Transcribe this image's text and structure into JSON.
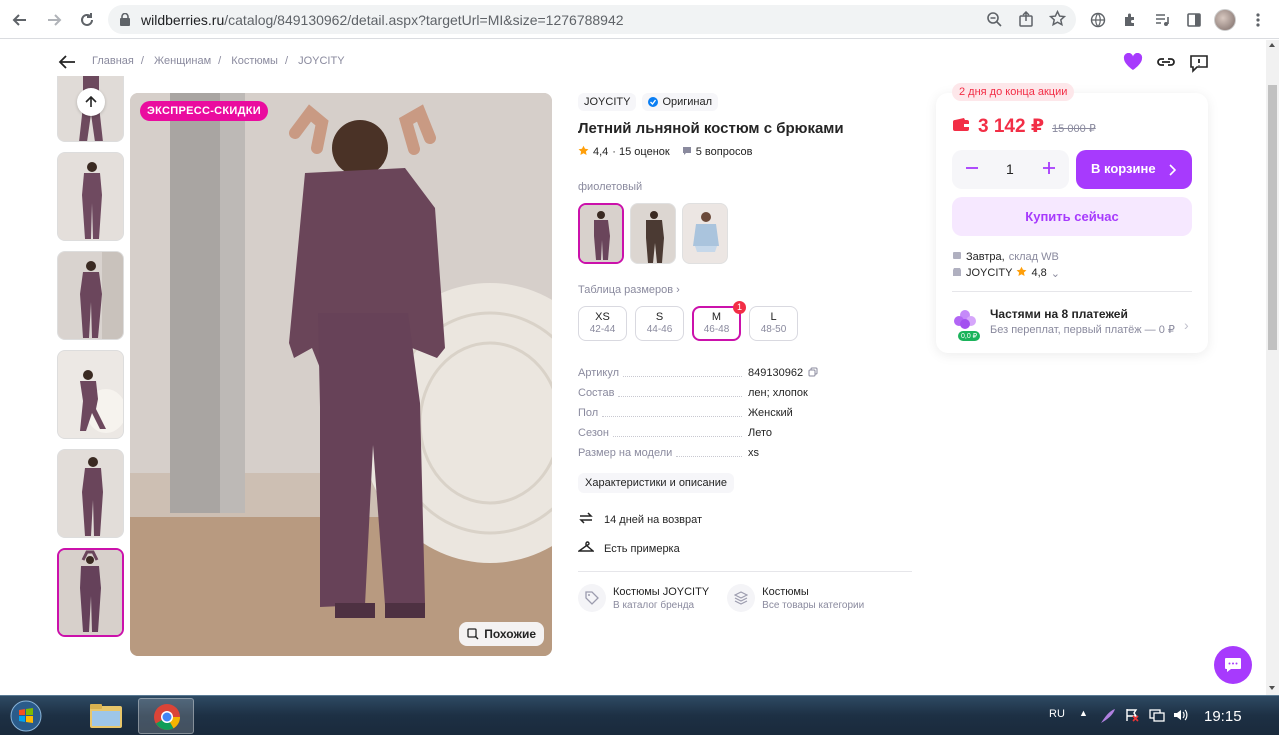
{
  "browser": {
    "url_host": "wildberries.ru",
    "url_rest": "/catalog/849130962/detail.aspx?targetUrl=MI&size=1276788942"
  },
  "breadcrumbs": [
    "Главная",
    "Женщинам",
    "Костюмы",
    "JOYCITY"
  ],
  "gallery": {
    "express_badge": "ЭКСПРЕСС-СКИДКИ",
    "similar_label": "Похожие"
  },
  "product": {
    "brand": "JOYCITY",
    "original_label": "Оригинал",
    "title": "Летний льняной костюм с брюками",
    "rating": "4,4",
    "reviews": "· 15 оценок",
    "questions": "5 вопросов",
    "color_label": "фиолетовый",
    "size_table_label": "Таблица размеров",
    "sizes": [
      {
        "name": "XS",
        "range": "42-44"
      },
      {
        "name": "S",
        "range": "44-46"
      },
      {
        "name": "M",
        "range": "46-48",
        "selected": true,
        "count": "1"
      },
      {
        "name": "L",
        "range": "48-50"
      }
    ],
    "specs": [
      {
        "k": "Артикул",
        "v": "849130962"
      },
      {
        "k": "Состав",
        "v": "лен; хлопок"
      },
      {
        "k": "Пол",
        "v": "Женский"
      },
      {
        "k": "Сезон",
        "v": "Лето"
      },
      {
        "k": "Размер на модели",
        "v": "xs"
      }
    ],
    "chars_button": "Характеристики и описание",
    "features": [
      "14 дней на возврат",
      "Есть примерка"
    ],
    "categories": [
      {
        "t1": "Костюмы JOYCITY",
        "t2": "В каталог бренда"
      },
      {
        "t1": "Костюмы",
        "t2": "Все товары категории"
      }
    ]
  },
  "buy": {
    "promo": "2 дня до конца акции",
    "price": "3 142 ₽",
    "old_price": "15 000 ₽",
    "qty": "1",
    "in_cart": "В корзине",
    "buy_now": "Купить сейчас",
    "delivery_day": "Завтра,",
    "delivery_place": "склад WB",
    "seller": "JOYCITY",
    "seller_rating": "4,8",
    "installments_title": "Частями на 8 платежей",
    "installments_sub": "Без переплат, первый платёж — 0 ₽",
    "installments_badge": "0,0 ₽"
  },
  "taskbar": {
    "lang": "RU",
    "clock": "19:15"
  },
  "colors": {
    "accent": "#a73afd",
    "brand": "#cb11ab",
    "price": "#f22e46"
  }
}
